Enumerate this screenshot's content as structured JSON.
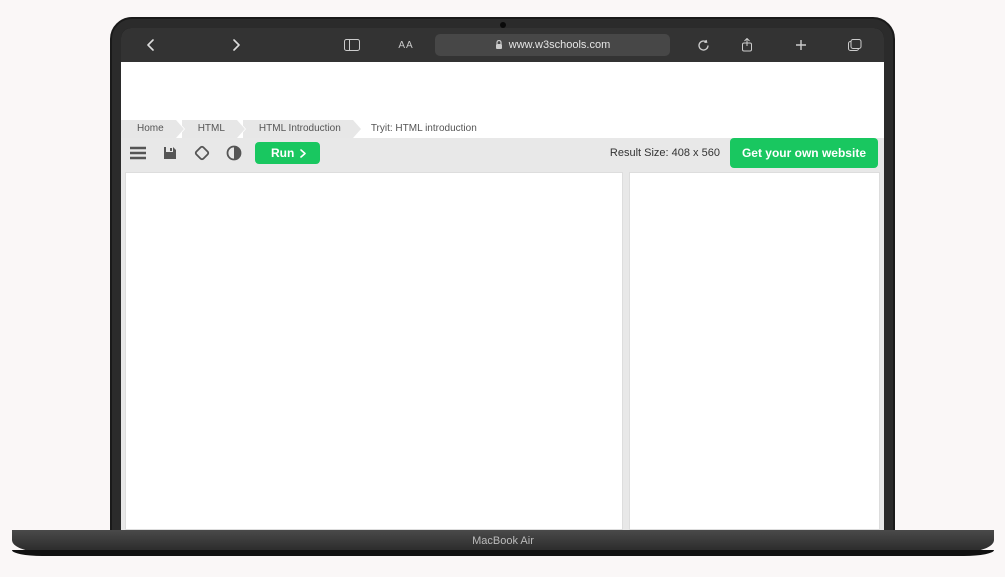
{
  "browser": {
    "url_host": "www.w3schools.com",
    "reader_label": "AA"
  },
  "laptop_model": "MacBook Air",
  "breadcrumb": {
    "items": [
      "Home",
      "HTML",
      "HTML Introduction"
    ],
    "current": "Tryit: HTML introduction"
  },
  "toolbar": {
    "run_label": "Run",
    "result_size_label": "Result Size: 408 x 560",
    "own_website_label": "Get your own website"
  }
}
